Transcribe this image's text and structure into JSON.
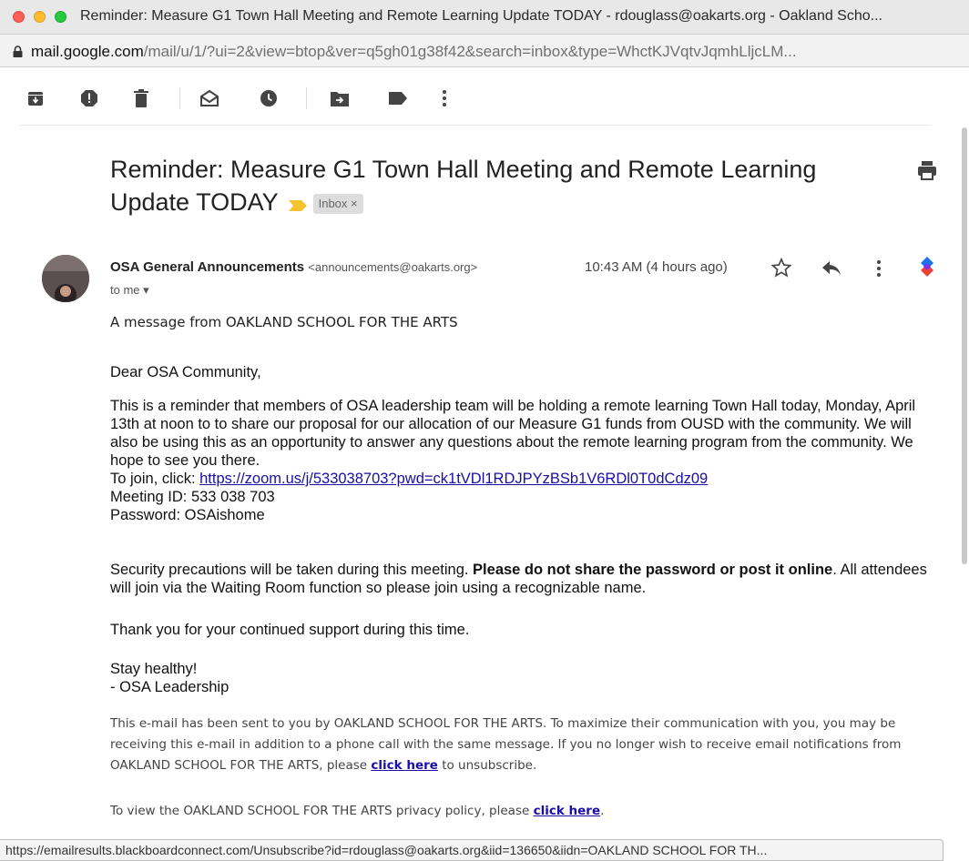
{
  "window": {
    "title": "Reminder: Measure G1 Town Hall Meeting and Remote Learning Update TODAY - rdouglass@oakarts.org - Oakland Scho..."
  },
  "address_bar": {
    "domain": "mail.google.com",
    "path": "/mail/u/1/?ui=2&view=btop&ver=q5gh01g38f42&search=inbox&type=WhctKJVqtvJqmhLljcLM..."
  },
  "toolbar": {
    "icons": [
      "archive-icon",
      "report-spam-icon",
      "delete-icon",
      "mark-unread-icon",
      "snooze-icon",
      "move-to-icon",
      "label-icon",
      "more-vert-icon"
    ]
  },
  "email": {
    "subject": "Reminder: Measure G1 Town Hall Meeting and Remote Learning Update TODAY",
    "label": "Inbox",
    "label_close": "×",
    "sender_name": "OSA General Announcements",
    "sender_email": "<announcements@oakarts.org>",
    "time": "10:43 AM (4 hours ago)",
    "to": "to me",
    "message_from": "A message from OAKLAND SCHOOL FOR THE ARTS",
    "greeting": "Dear OSA Community,",
    "paragraph1": "This is a reminder that members of OSA leadership team will be holding a remote learning Town Hall today, Monday, April 13th at noon to to share our proposal for our allocation of our Measure G1 funds from OUSD with the community.  We will also be using this as an opportunity to answer any questions about the remote learning program from the community. We hope to see you there.",
    "join_prefix": "To join, click: ",
    "join_link": "https://zoom.us/j/533038703?pwd=ck1tVDl1RDJPYzBSb1V6RDl0T0dCdz09",
    "meeting_id": "Meeting ID: 533 038 703",
    "password": "Password: OSAishome",
    "security_prefix": "Security precautions will be taken during this meeting. ",
    "security_bold": "Please do not share the password or post it online",
    "security_suffix": ". All attendees will join via the Waiting Room function so please join using a recognizable name.",
    "thanks": "Thank you for your continued support during this time.",
    "closing": "Stay healthy!",
    "signature": "- OSA Leadership",
    "footer_text1": "This e-mail has been sent to you by OAKLAND SCHOOL FOR THE ARTS. To maximize their communication with you, you may be receiving this e-mail in addition to a phone call with the same message. If you no longer wish to receive email notifications from OAKLAND SCHOOL FOR THE ARTS, please ",
    "footer_link1": "click here",
    "footer_text1_end": " to unsubscribe.",
    "footer_text2": "To view the OAKLAND SCHOOL FOR THE ARTS privacy policy, please ",
    "footer_link2": "click here",
    "footer_text2_end": "."
  },
  "status_bar": {
    "url": "https://emailresults.blackboardconnect.com/Unsubscribe?id=rdouglass@oakarts.org&iid=136650&iidn=OAKLAND SCHOOL FOR TH..."
  },
  "colors": {
    "link": "#1a0dab",
    "important_marker": "#f4c430",
    "addon_blue": "#1a73e8",
    "addon_red": "#ea4335"
  }
}
